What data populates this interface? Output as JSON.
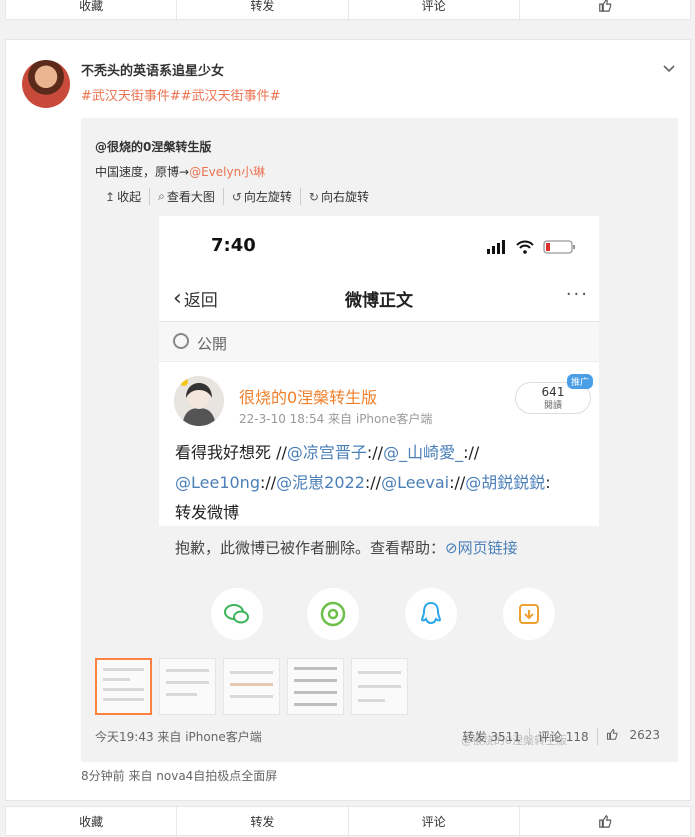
{
  "top_actions": [
    "收藏",
    "转发",
    "评论"
  ],
  "bottom_actions": [
    "收藏",
    "转发",
    "评论"
  ],
  "post": {
    "username": "不秃头的英语系追星少女",
    "topics": "#武汉天街事件##武汉天街事件#",
    "source_line": "8分钟前  来自 nova4自拍极点全面屏"
  },
  "quote": {
    "author": "@很烧的0涅槃转生版",
    "text_prefix": "中国速度，原博→",
    "text_link": "@Evelyn小琳",
    "tools": [
      "收起",
      "查看大图",
      "向左旋转",
      "向右旋转"
    ],
    "footer": "今天19:43 来自 iPhone客户端",
    "repost": "转发 3511",
    "comment": "评论 118",
    "like": "2623"
  },
  "screenshot": {
    "time": "7:40",
    "back_label": "返回",
    "title": "微博正文",
    "visibility": "公開",
    "user": "很烧的0涅槃转生版",
    "meta": "22-3-10 18:54  来自 iPhone客户端",
    "reads_count": "641",
    "reads_label": "閱讀",
    "tag": "推广",
    "content_line1_a": "看得我好想死 //",
    "content_line1_m1": "@凉宫晋子",
    "content_line1_b": "://",
    "content_line1_m2": "@_山崎愛_",
    "content_line1_c": "://",
    "content_line2_m1": "@Lee10ng",
    "content_line2_a": "://",
    "content_line2_m2": "@泥崽2022",
    "content_line2_b": "://",
    "content_line2_m3": "@Leevai",
    "content_line2_c": "://",
    "content_line2_m4": "@胡鋭鋭鋭",
    "content_line2_d": ":",
    "content_line3": "转发微博",
    "deleted_text": "抱歉，此微博已被作者删除。查看帮助：",
    "deleted_link": "网页链接",
    "watermark": "@很烧的0涅槃转生版"
  }
}
